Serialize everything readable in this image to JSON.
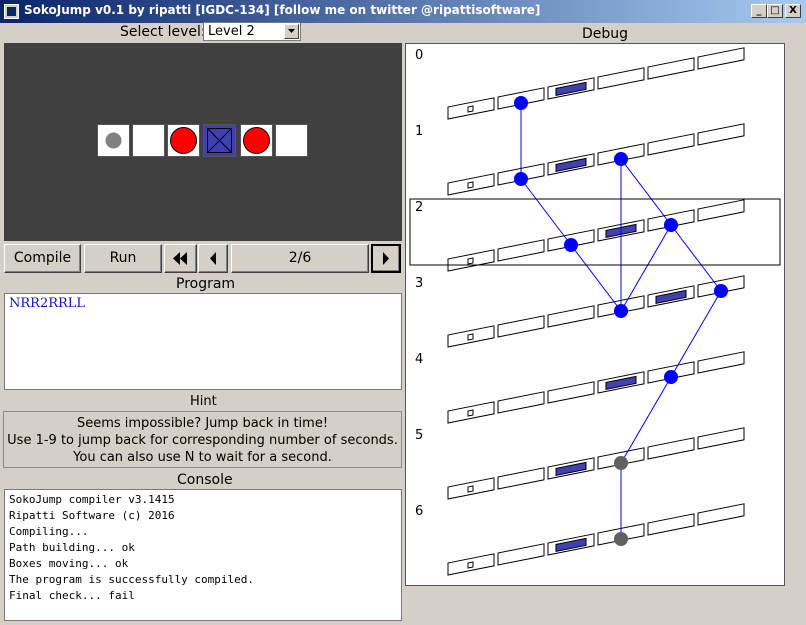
{
  "window": {
    "title": "SokoJump v0.1 by ripatti [IGDC-134] [follow me on twitter @ripattisoftware]",
    "minimize": "_",
    "maximize": "□",
    "close": "X"
  },
  "level": {
    "label": "Select level:",
    "value": "Level 2"
  },
  "debug": {
    "title": "Debug",
    "time_labels": [
      "0",
      "1",
      "2",
      "3",
      "4",
      "5",
      "6"
    ]
  },
  "game": {
    "cells": [
      "player",
      "empty",
      "red-ball",
      "box",
      "red-ball",
      "empty"
    ]
  },
  "controls": {
    "compile": "Compile",
    "run": "Run",
    "first_icon": "rewind-icon",
    "prev_icon": "step-back-icon",
    "next_icon": "step-forward-icon",
    "step": "2/6"
  },
  "program": {
    "title": "Program",
    "code": "NRR2RRLL"
  },
  "hint": {
    "title": "Hint",
    "lines": [
      "Seems impossible? Jump back in time!",
      "Use 1-9 to jump back for corresponding number of seconds.",
      "You can also use N to wait for a second."
    ]
  },
  "console": {
    "title": "Console",
    "lines": [
      "SokoJump compiler v3.1415",
      "Ripatti Software (c) 2016",
      "Compiling...",
      "Path building... ok",
      "Boxes moving... ok",
      "The program is successfully compiled.",
      "Final check... fail"
    ]
  },
  "colors": {
    "player_active": "#0000ff",
    "player_past": "#606060",
    "box": "#4040b0",
    "ball": "#ff0000",
    "titlebar": "#0a246a"
  },
  "debug_rows": [
    {
      "target": 0,
      "boxes": [
        2
      ],
      "dots": [
        {
          "col": 1,
          "color": "#0000ff"
        }
      ]
    },
    {
      "target": 0,
      "boxes": [
        2
      ],
      "dots": [
        {
          "col": 1,
          "color": "#0000ff"
        },
        {
          "col": 3,
          "color": "#0000ff"
        }
      ]
    },
    {
      "target": 0,
      "boxes": [
        3
      ],
      "dots": [
        {
          "col": 2,
          "color": "#0000ff"
        },
        {
          "col": 4,
          "color": "#0000ff"
        }
      ]
    },
    {
      "target": 0,
      "boxes": [
        4
      ],
      "dots": [
        {
          "col": 3,
          "color": "#0000ff"
        },
        {
          "col": 5,
          "color": "#0000ff"
        }
      ]
    },
    {
      "target": 0,
      "boxes": [
        3
      ],
      "dots": [
        {
          "col": 4,
          "color": "#0000ff"
        }
      ]
    },
    {
      "target": 0,
      "boxes": [
        2
      ],
      "dots": [
        {
          "col": 3,
          "color": "#606060"
        }
      ]
    },
    {
      "target": 0,
      "boxes": [
        2
      ],
      "dots": [
        {
          "col": 3,
          "color": "#606060"
        }
      ]
    }
  ],
  "debug_lines": [
    [
      0,
      1,
      1,
      1
    ],
    [
      1,
      1,
      2,
      2
    ],
    [
      1,
      3,
      3,
      3
    ],
    [
      1,
      3,
      2,
      4
    ],
    [
      2,
      2,
      3,
      3
    ],
    [
      2,
      4,
      3,
      5
    ],
    [
      2,
      4,
      3,
      3
    ],
    [
      3,
      5,
      4,
      4
    ],
    [
      4,
      4,
      5,
      3
    ],
    [
      5,
      3,
      6,
      3
    ]
  ],
  "debug_highlight": 2
}
